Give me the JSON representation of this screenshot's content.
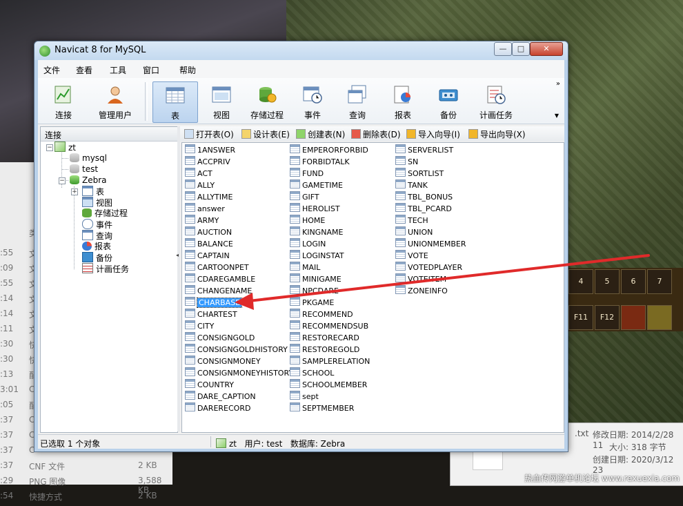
{
  "window": {
    "title": "Navicat 8 for MySQL",
    "buttons": {
      "minimize": "—",
      "maximize": "□",
      "close": "✕"
    }
  },
  "menu": [
    "文件",
    "查看",
    "工具",
    "窗口",
    "帮助"
  ],
  "toolbar": {
    "buttons": [
      {
        "label": "连接",
        "icon": "connection-icon"
      },
      {
        "label": "管理用户",
        "icon": "user-icon"
      },
      {
        "label": "表",
        "icon": "table-icon",
        "active": true
      },
      {
        "label": "视图",
        "icon": "view-icon"
      },
      {
        "label": "存储过程",
        "icon": "procedure-icon"
      },
      {
        "label": "事件",
        "icon": "event-icon"
      },
      {
        "label": "查询",
        "icon": "query-icon"
      },
      {
        "label": "报表",
        "icon": "report-icon"
      },
      {
        "label": "备份",
        "icon": "backup-icon"
      },
      {
        "label": "计画任务",
        "icon": "schedule-icon"
      }
    ],
    "overflow": "»"
  },
  "connection_panel": {
    "header": "连接",
    "tree": {
      "root": "zt",
      "databases": [
        "mysql",
        "test",
        "Zebra"
      ],
      "zebra_children": [
        "表",
        "视图",
        "存储过程",
        "事件",
        "查询",
        "报表",
        "备份",
        "计画任务"
      ]
    }
  },
  "object_toolbar": [
    "打开表(O)",
    "设计表(E)",
    "创建表(N)",
    "删除表(D)",
    "导入向导(I)",
    "导出向导(X)"
  ],
  "tables": {
    "col1": [
      "1ANSWER",
      "ACCPRIV",
      "ACT",
      "ALLY",
      "ALLYTIME",
      "answer",
      "ARMY",
      "AUCTION",
      "BALANCE",
      "CAPTAIN",
      "CARTOONPET",
      "CDAREGAMBLE",
      "CHANGENAME",
      "CHARBASE",
      "CHARTEST",
      "CITY",
      "CONSIGNGOLD",
      "CONSIGNGOLDHISTORY",
      "CONSIGNMONEY",
      "CONSIGNMONEYHISTORY",
      "COUNTRY",
      "DARE_CAPTION",
      "DARERECORD"
    ],
    "col2": [
      "EMPERORFORBID",
      "FORBIDTALK",
      "FUND",
      "GAMETIME",
      "GIFT",
      "HEROLIST",
      "HOME",
      "KINGNAME",
      "LOGIN",
      "LOGINSTAT",
      "MAIL",
      "MINIGAME",
      "NPCDARE",
      "PKGAME",
      "RECOMMEND",
      "RECOMMENDSUB",
      "RESTORECARD",
      "RESTOREGOLD",
      "SAMPLERELATION",
      "SCHOOL",
      "SCHOOLMEMBER",
      "sept",
      "SEPTMEMBER"
    ],
    "col3": [
      "SERVERLIST",
      "SN",
      "SORTLIST",
      "TANK",
      "TBL_BONUS",
      "TBL_PCARD",
      "TECH",
      "UNION",
      "UNIONMEMBER",
      "VOTE",
      "VOTEDPLAYER",
      "VOTEITEM",
      "ZONEINFO"
    ],
    "selected": "CHARBASE"
  },
  "status": {
    "left": "已选取 1 个对象",
    "connection": "zt",
    "user": "用户: test",
    "database": "数据库: Zebra"
  },
  "background": {
    "file_rows": [
      {
        "time": ":55",
        "type": "文"
      },
      {
        "time": ":09",
        "type": "文"
      },
      {
        "time": ":55",
        "type": "文"
      },
      {
        "time": ":14",
        "type": "文"
      },
      {
        "time": ":14",
        "type": "文"
      },
      {
        "time": ":11",
        "type": "文"
      },
      {
        "time": ":30",
        "type": "快"
      },
      {
        "time": ":30",
        "type": "快"
      },
      {
        "time": ":13",
        "type": "配"
      },
      {
        "time": "3:01",
        "type": "C"
      },
      {
        "time": ":05",
        "type": "配"
      },
      {
        "time": ":37",
        "type": "C"
      },
      {
        "time": ":37",
        "type": "C"
      },
      {
        "time": ":37",
        "type": "C"
      },
      {
        "time": ":37",
        "type": "CNF 文件",
        "size": "2 KB"
      },
      {
        "time": ":29",
        "type": "PNG 图像",
        "size": "3,588 KB"
      },
      {
        "time": ":54",
        "type": "快捷方式",
        "size": "2 KB"
      }
    ],
    "list_header_fragment": "类",
    "hotkeys": [
      "4",
      "5",
      "6",
      "7"
    ],
    "fkeys": [
      "F11",
      "F12"
    ],
    "properties": {
      "ext": ".txt",
      "modified": "修改日期: 2014/2/28 11",
      "size": "大小: 318 字节",
      "created": "创建日期: 2020/3/12 23"
    },
    "watermark": "热血传网游单机论坛 www.rexuexia.com"
  }
}
